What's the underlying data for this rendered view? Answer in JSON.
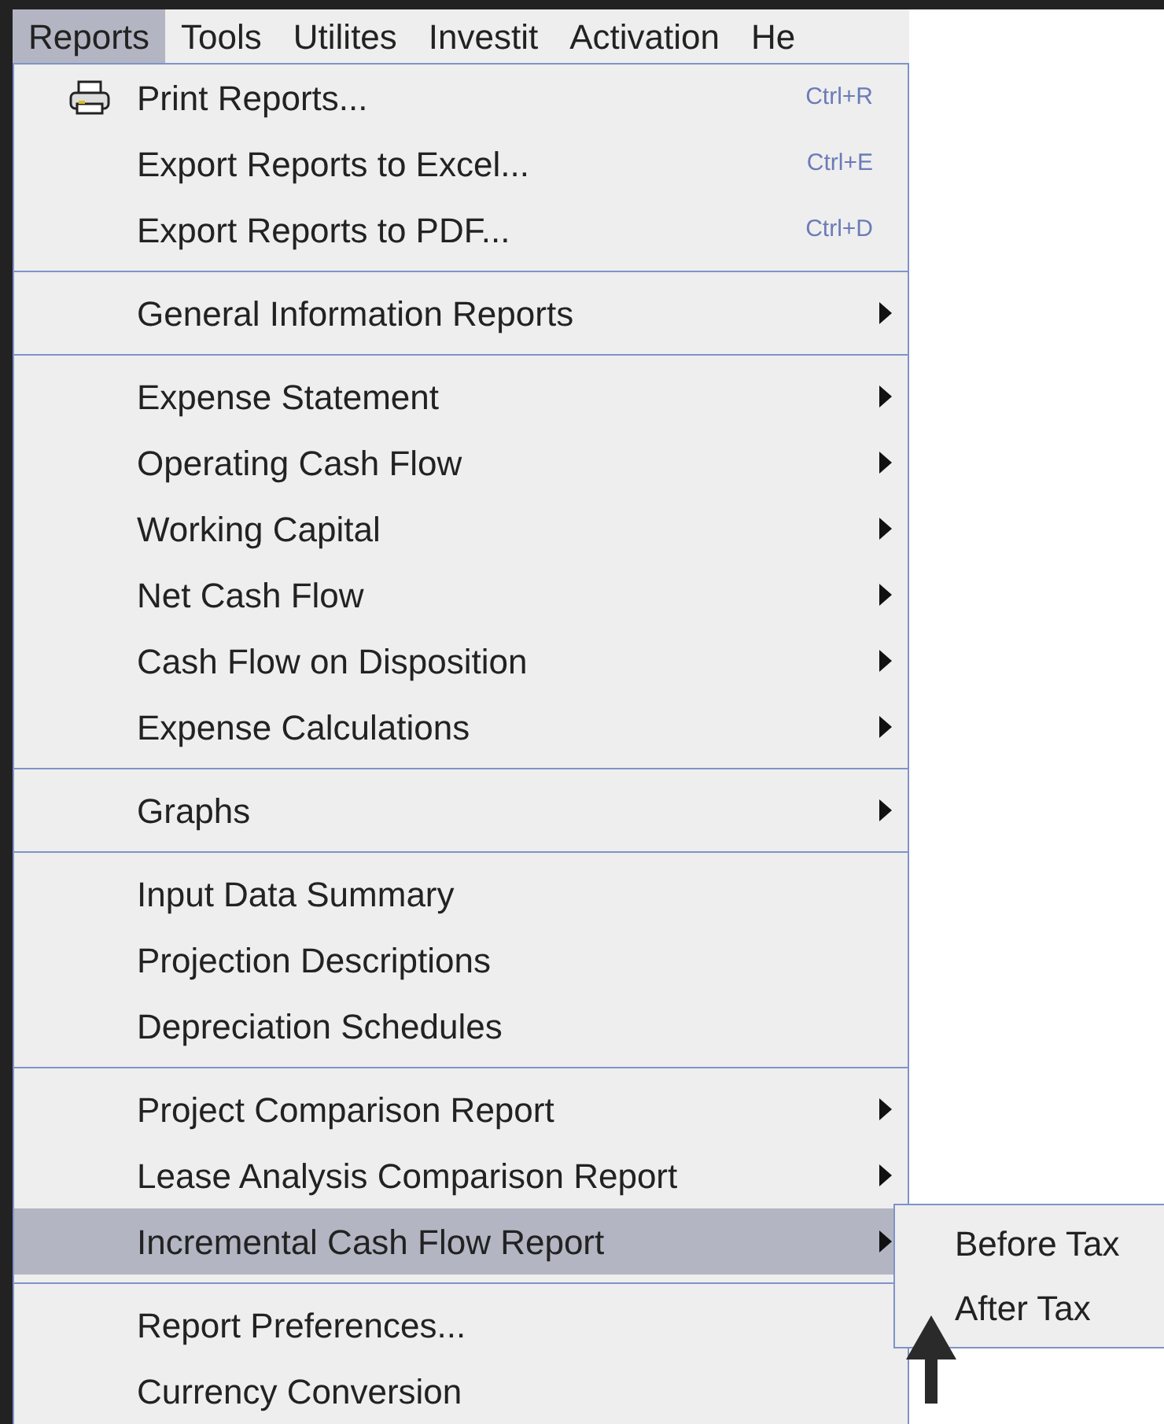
{
  "menubar": [
    {
      "label": "Reports",
      "selected": true
    },
    {
      "label": "Tools",
      "selected": false
    },
    {
      "label": "Utilites",
      "selected": false
    },
    {
      "label": "Investit",
      "selected": false
    },
    {
      "label": "Activation",
      "selected": false
    },
    {
      "label": "He",
      "selected": false
    }
  ],
  "menu": {
    "sections": [
      [
        {
          "label": "Print Reports...",
          "shortcut": "Ctrl+R",
          "kind": "print",
          "submenu": false,
          "selected": false
        },
        {
          "label": "Export Reports to Excel...",
          "shortcut": "Ctrl+E",
          "submenu": false,
          "selected": false
        },
        {
          "label": "Export Reports to PDF...",
          "shortcut": "Ctrl+D",
          "submenu": false,
          "selected": false
        }
      ],
      [
        {
          "label": "General Information Reports",
          "submenu": true,
          "selected": false
        }
      ],
      [
        {
          "label": "Expense Statement",
          "submenu": true,
          "selected": false
        },
        {
          "label": "Operating Cash Flow",
          "submenu": true,
          "selected": false
        },
        {
          "label": "Working Capital",
          "submenu": true,
          "selected": false
        },
        {
          "label": "Net Cash Flow",
          "submenu": true,
          "selected": false
        },
        {
          "label": "Cash Flow on Disposition",
          "submenu": true,
          "selected": false
        },
        {
          "label": "Expense Calculations",
          "submenu": true,
          "selected": false
        }
      ],
      [
        {
          "label": "Graphs",
          "submenu": true,
          "selected": false
        }
      ],
      [
        {
          "label": "Input Data Summary",
          "submenu": false,
          "selected": false
        },
        {
          "label": "Projection Descriptions",
          "submenu": false,
          "selected": false
        },
        {
          "label": "Depreciation Schedules",
          "submenu": false,
          "selected": false
        }
      ],
      [
        {
          "label": "Project Comparison Report",
          "submenu": true,
          "selected": false
        },
        {
          "label": "Lease Analysis Comparison Report",
          "submenu": true,
          "selected": false
        },
        {
          "label": "Incremental Cash Flow Report",
          "submenu": true,
          "selected": true
        }
      ],
      [
        {
          "label": "Report Preferences...",
          "submenu": false,
          "selected": false
        },
        {
          "label": "Currency Conversion",
          "submenu": false,
          "selected": false
        }
      ]
    ]
  },
  "submenu": {
    "items": [
      {
        "label": "Before Tax",
        "selected": false
      },
      {
        "label": "After Tax",
        "selected": false
      }
    ]
  }
}
